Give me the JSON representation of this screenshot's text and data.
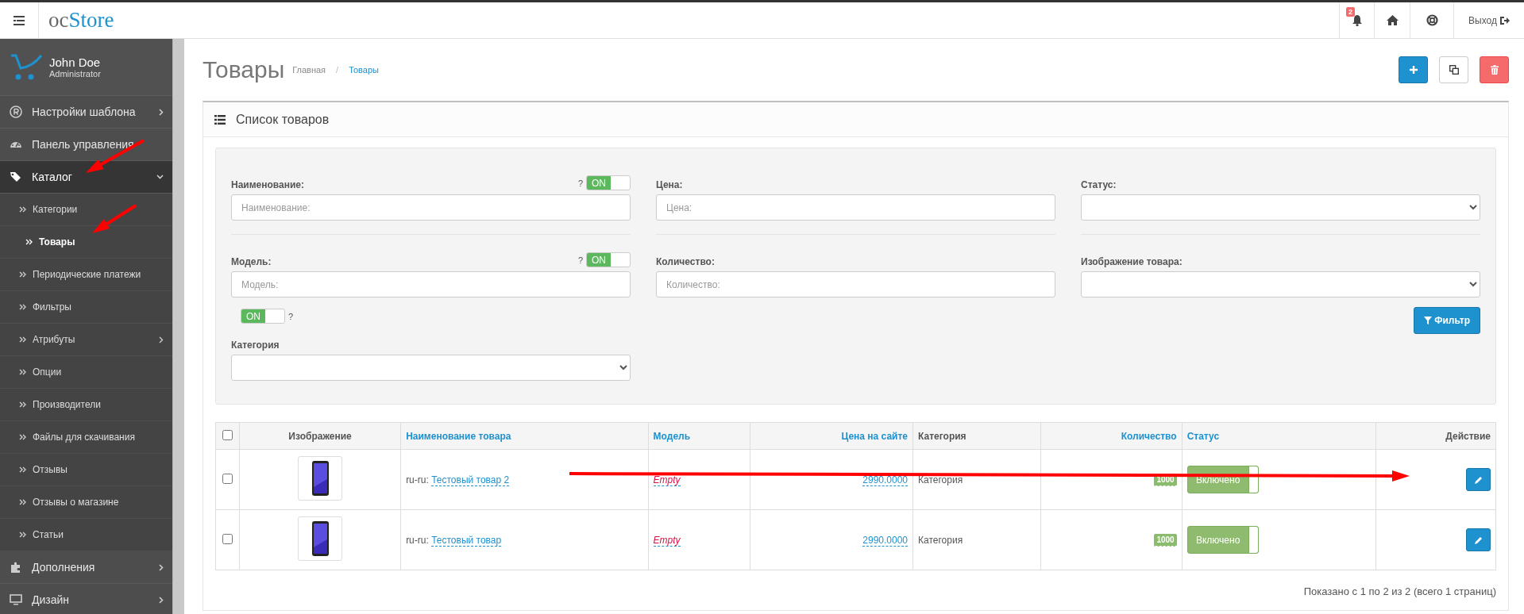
{
  "header": {
    "logo": {
      "prefix": "oc",
      "name": "Store"
    },
    "notification_count": "2",
    "logout": "Выход"
  },
  "sidebar": {
    "user": {
      "name": "John Doe",
      "role": "Administrator"
    },
    "items": [
      {
        "label": "Настройки шаблона",
        "has_submenu": true,
        "expanded": false
      },
      {
        "label": "Панель управления",
        "has_submenu": false,
        "expanded": false
      },
      {
        "label": "Каталог",
        "has_submenu": true,
        "expanded": true,
        "children": [
          {
            "label": "Категории",
            "selected": false,
            "has_submenu": false
          },
          {
            "label": "Товары",
            "selected": true,
            "has_submenu": false
          },
          {
            "label": "Периодические платежи",
            "selected": false,
            "has_submenu": false
          },
          {
            "label": "Фильтры",
            "selected": false,
            "has_submenu": false
          },
          {
            "label": "Атрибуты",
            "selected": false,
            "has_submenu": true
          },
          {
            "label": "Опции",
            "selected": false,
            "has_submenu": false
          },
          {
            "label": "Производители",
            "selected": false,
            "has_submenu": false
          },
          {
            "label": "Файлы для скачивания",
            "selected": false,
            "has_submenu": false
          },
          {
            "label": "Отзывы",
            "selected": false,
            "has_submenu": false
          },
          {
            "label": "Отзывы о магазине",
            "selected": false,
            "has_submenu": false
          },
          {
            "label": "Статьи",
            "selected": false,
            "has_submenu": false
          }
        ]
      },
      {
        "label": "Дополнения",
        "has_submenu": true,
        "expanded": false
      },
      {
        "label": "Дизайн",
        "has_submenu": true,
        "expanded": false
      }
    ]
  },
  "main": {
    "title": "Товары",
    "breadcrumb_separator": "/",
    "breadcrumbs": [
      {
        "label": "Главная",
        "current": false
      },
      {
        "label": "Товары",
        "current": true
      }
    ],
    "panel_title": "Список товаров",
    "filter": {
      "columns": [
        [
          {
            "kind": "text",
            "label": "Наименование:",
            "placeholder": "Наименование:",
            "toggle": {
              "on": true,
              "text": "ON",
              "hint": "?"
            }
          },
          {
            "kind": "text",
            "label": "Модель:",
            "placeholder": "Модель:",
            "toggle": {
              "on": true,
              "text": "ON",
              "hint": "?"
            }
          },
          {
            "kind": "toggle",
            "on": true,
            "text": "ON",
            "hint": "?"
          },
          {
            "kind": "select",
            "label": "Категория"
          }
        ],
        [
          {
            "kind": "text",
            "label": "Цена:",
            "placeholder": "Цена:"
          },
          {
            "kind": "text",
            "label": "Количество:",
            "placeholder": "Количество:"
          }
        ],
        [
          {
            "kind": "select",
            "label": "Статус:"
          },
          {
            "kind": "select",
            "label": "Изображение товара:"
          }
        ]
      ],
      "button": "Фильтр"
    },
    "table": {
      "select_all_checked": false,
      "columns": [
        {
          "label": "Изображение",
          "sortable": false
        },
        {
          "label": "Наименование товара",
          "sortable": true
        },
        {
          "label": "Модель",
          "sortable": true
        },
        {
          "label": "Цена на сайте",
          "sortable": true
        },
        {
          "label": "Категория",
          "sortable": false
        },
        {
          "label": "Количество",
          "sortable": true
        },
        {
          "label": "Статус",
          "sortable": true
        },
        {
          "label": "Действие",
          "sortable": false
        }
      ],
      "rows": [
        {
          "checked": false,
          "lang": "ru-ru:",
          "name": "Тестовый товар 2",
          "model": "Empty",
          "price": "2990.0000",
          "category": "Категория",
          "quantity": "1000",
          "status": "Включено",
          "status_on": true
        },
        {
          "checked": false,
          "lang": "ru-ru:",
          "name": "Тестовый товар",
          "model": "Empty",
          "price": "2990.0000",
          "category": "Категория",
          "quantity": "1000",
          "status": "Включено",
          "status_on": true
        }
      ]
    },
    "pagination_text": "Показано с 1 по 2 из 2 (всего 1 страниц)"
  }
}
